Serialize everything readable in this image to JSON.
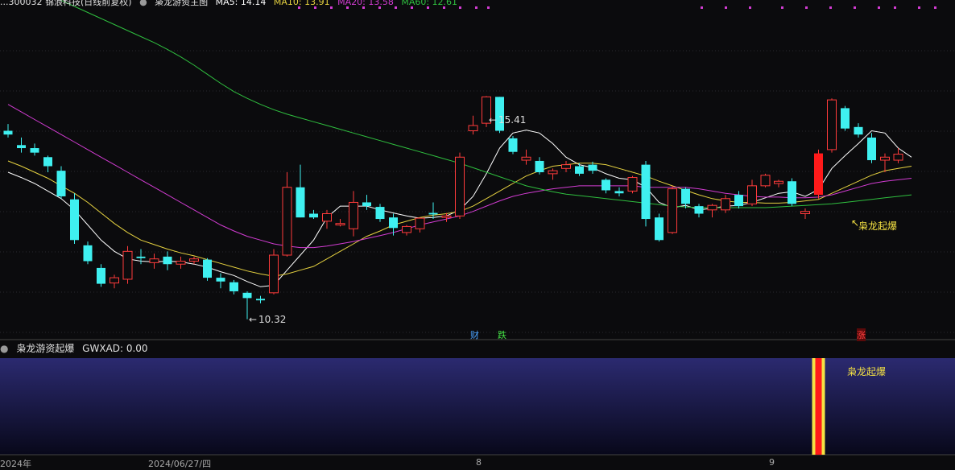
{
  "top_legend": {
    "stock": "...300032 锦浪科技(日线前复权)",
    "indicator_name": "枭龙游资主图",
    "ma5": "MA5: 14.14",
    "ma10": "MA10: 13.91",
    "ma20": "MA20: 13.58",
    "ma60": "MA60: 12.61"
  },
  "colors": {
    "up": "#ff3b3b",
    "down": "#3ff0f0",
    "ma5": "#ffffff",
    "ma10": "#e6d240",
    "ma20": "#d23cd2",
    "ma60": "#2fbf3f",
    "panel_top": "#2a2a6e",
    "panel_bottom": "#0a0a18"
  },
  "annotations": {
    "high": "15.41",
    "low": "10.32",
    "signal": "枭龙起爆",
    "badge_cai": "财",
    "badge_die": "跌",
    "badge_zhang": "涨"
  },
  "indicator": {
    "title": "枭龙游资起爆",
    "value_label": "GWXAD: 0.00",
    "bar_label": "枭龙起爆"
  },
  "x_axis": {
    "label_year": "2024年",
    "label_date": "2024/06/27/四",
    "label_month8": "8",
    "label_month9": "9"
  },
  "chart_data": {
    "type": "candlestick",
    "series": [
      {
        "name": "K",
        "ohlc": [
          [
            14.95,
            15.04,
            14.86,
            14.9
          ],
          [
            14.76,
            14.86,
            14.66,
            14.72
          ],
          [
            14.72,
            14.78,
            14.62,
            14.66
          ],
          [
            14.6,
            14.62,
            14.4,
            14.48
          ],
          [
            14.42,
            14.48,
            14.05,
            14.08
          ],
          [
            14.04,
            14.12,
            13.45,
            13.5
          ],
          [
            13.43,
            13.48,
            13.18,
            13.22
          ],
          [
            13.13,
            13.18,
            12.88,
            12.92
          ],
          [
            12.93,
            13.04,
            12.86,
            13.0
          ],
          [
            12.98,
            13.42,
            12.92,
            13.35
          ],
          [
            13.28,
            13.38,
            13.18,
            13.26
          ],
          [
            13.2,
            13.32,
            13.12,
            13.25
          ],
          [
            13.28,
            13.35,
            13.1,
            13.18
          ],
          [
            13.18,
            13.28,
            13.12,
            13.22
          ],
          [
            13.22,
            13.28,
            13.18,
            13.25
          ],
          [
            13.24,
            13.26,
            12.96,
            13.0
          ],
          [
            13.0,
            13.06,
            12.86,
            12.95
          ],
          [
            12.94,
            12.97,
            12.78,
            12.82
          ],
          [
            12.8,
            12.82,
            12.45,
            12.73
          ],
          [
            12.72,
            12.76,
            12.66,
            12.7
          ],
          [
            12.8,
            13.38,
            12.78,
            13.3
          ],
          [
            13.3,
            14.4,
            13.28,
            14.2
          ],
          [
            14.2,
            14.5,
            13.8,
            13.8
          ],
          [
            13.85,
            13.9,
            13.78,
            13.8
          ],
          [
            13.75,
            13.9,
            13.65,
            13.85
          ],
          [
            13.7,
            13.78,
            13.68,
            13.72
          ],
          [
            13.65,
            14.15,
            13.55,
            14.0
          ],
          [
            14.0,
            14.1,
            13.9,
            13.95
          ],
          [
            13.94,
            13.98,
            13.74,
            13.78
          ],
          [
            13.8,
            13.85,
            13.56,
            13.66
          ],
          [
            13.6,
            13.7,
            13.56,
            13.68
          ],
          [
            13.65,
            13.8,
            13.6,
            13.79
          ],
          [
            13.86,
            14.0,
            13.78,
            13.84
          ],
          [
            13.8,
            13.86,
            13.74,
            13.82
          ],
          [
            13.82,
            14.66,
            13.78,
            14.6
          ],
          [
            14.95,
            15.15,
            14.9,
            15.02
          ],
          [
            15.05,
            15.41,
            15.0,
            15.4
          ],
          [
            15.4,
            15.4,
            14.92,
            14.95
          ],
          [
            14.85,
            14.88,
            14.64,
            14.67
          ],
          [
            14.56,
            14.7,
            14.5,
            14.6
          ],
          [
            14.55,
            14.6,
            14.37,
            14.4
          ],
          [
            14.38,
            14.45,
            14.3,
            14.42
          ],
          [
            14.45,
            14.55,
            14.4,
            14.5
          ],
          [
            14.48,
            14.52,
            14.35,
            14.38
          ],
          [
            14.5,
            14.54,
            14.38,
            14.42
          ],
          [
            14.3,
            14.32,
            14.12,
            14.16
          ],
          [
            14.15,
            14.2,
            14.08,
            14.12
          ],
          [
            14.15,
            14.35,
            14.12,
            14.33
          ],
          [
            14.5,
            14.55,
            13.68,
            13.78
          ],
          [
            13.8,
            13.85,
            13.48,
            13.5
          ],
          [
            13.6,
            14.22,
            13.58,
            14.18
          ],
          [
            14.18,
            14.2,
            13.92,
            13.98
          ],
          [
            13.95,
            13.98,
            13.8,
            13.85
          ],
          [
            13.9,
            13.98,
            13.8,
            13.96
          ],
          [
            13.9,
            14.1,
            13.86,
            14.05
          ],
          [
            14.1,
            14.15,
            13.92,
            13.95
          ],
          [
            13.98,
            14.3,
            13.95,
            14.22
          ],
          [
            14.22,
            14.38,
            14.2,
            14.36
          ],
          [
            14.25,
            14.3,
            14.2,
            14.28
          ],
          [
            14.28,
            14.32,
            13.95,
            13.98
          ],
          [
            13.85,
            13.92,
            13.78,
            13.88
          ],
          [
            14.1,
            14.7,
            14.05,
            14.65
          ],
          [
            14.7,
            15.38,
            14.66,
            15.36
          ],
          [
            15.25,
            15.28,
            14.95,
            14.98
          ],
          [
            15.0,
            15.05,
            14.86,
            14.9
          ],
          [
            14.86,
            14.92,
            14.52,
            14.56
          ],
          [
            14.56,
            14.65,
            14.4,
            14.6
          ],
          [
            14.56,
            14.72,
            14.52,
            14.64
          ]
        ]
      },
      {
        "name": "MA5",
        "values": [
          14.4,
          14.33,
          14.25,
          14.15,
          14.05,
          13.9,
          13.7,
          13.5,
          13.35,
          13.25,
          13.22,
          13.21,
          13.22,
          13.21,
          13.18,
          13.14,
          13.08,
          13.03,
          12.95,
          12.88,
          12.9,
          13.1,
          13.3,
          13.5,
          13.8,
          13.95,
          13.95,
          13.95,
          13.9,
          13.86,
          13.82,
          13.79,
          13.8,
          13.82,
          13.9,
          14.08,
          14.38,
          14.72,
          14.92,
          14.96,
          14.92,
          14.78,
          14.6,
          14.5,
          14.46,
          14.38,
          14.32,
          14.3,
          14.2,
          14.0,
          13.93,
          13.96,
          13.9,
          13.92,
          13.95,
          13.96,
          14.0,
          14.06,
          14.12,
          14.14,
          14.08,
          14.17,
          14.45,
          14.62,
          14.78,
          14.95,
          14.92,
          14.72,
          14.6
        ]
      },
      {
        "name": "MA10",
        "values": [
          14.55,
          14.48,
          14.4,
          14.32,
          14.22,
          14.12,
          14.0,
          13.86,
          13.72,
          13.6,
          13.5,
          13.44,
          13.38,
          13.33,
          13.29,
          13.24,
          13.19,
          13.14,
          13.09,
          13.05,
          13.02,
          13.05,
          13.1,
          13.15,
          13.25,
          13.35,
          13.45,
          13.55,
          13.62,
          13.7,
          13.75,
          13.8,
          13.83,
          13.85,
          13.88,
          13.95,
          14.05,
          14.15,
          14.25,
          14.35,
          14.42,
          14.48,
          14.5,
          14.52,
          14.52,
          14.5,
          14.45,
          14.4,
          14.35,
          14.28,
          14.22,
          14.16,
          14.1,
          14.05,
          14.02,
          14.0,
          14.0,
          13.99,
          13.99,
          14.0,
          14.02,
          14.04,
          14.12,
          14.2,
          14.28,
          14.36,
          14.42,
          14.45,
          14.48
        ]
      },
      {
        "name": "MA20",
        "values": [
          15.3,
          15.2,
          15.1,
          15.0,
          14.9,
          14.8,
          14.7,
          14.6,
          14.5,
          14.4,
          14.3,
          14.2,
          14.1,
          14.0,
          13.9,
          13.8,
          13.7,
          13.62,
          13.55,
          13.5,
          13.45,
          13.42,
          13.4,
          13.4,
          13.42,
          13.45,
          13.48,
          13.52,
          13.56,
          13.6,
          13.65,
          13.7,
          13.74,
          13.78,
          13.82,
          13.88,
          13.95,
          14.02,
          14.08,
          14.12,
          14.15,
          14.18,
          14.2,
          14.22,
          14.22,
          14.22,
          14.22,
          14.22,
          14.2,
          14.2,
          14.2,
          14.2,
          14.18,
          14.15,
          14.12,
          14.1,
          14.08,
          14.07,
          14.07,
          14.06,
          14.06,
          14.07,
          14.1,
          14.15,
          14.2,
          14.25,
          14.28,
          14.3,
          14.32
        ]
      },
      {
        "name": "MA60",
        "values": [
          17.0,
          16.92,
          16.84,
          16.76,
          16.68,
          16.6,
          16.52,
          16.44,
          16.36,
          16.28,
          16.2,
          16.12,
          16.03,
          15.93,
          15.82,
          15.7,
          15.58,
          15.47,
          15.38,
          15.3,
          15.23,
          15.17,
          15.12,
          15.07,
          15.02,
          14.97,
          14.92,
          14.87,
          14.82,
          14.77,
          14.72,
          14.67,
          14.62,
          14.57,
          14.52,
          14.46,
          14.4,
          14.34,
          14.28,
          14.22,
          14.18,
          14.14,
          14.11,
          14.09,
          14.07,
          14.05,
          14.03,
          14.01,
          13.99,
          13.97,
          13.95,
          13.94,
          13.93,
          13.93,
          13.93,
          13.93,
          13.93,
          13.93,
          13.94,
          13.95,
          13.96,
          13.97,
          13.98,
          14.0,
          14.02,
          14.04,
          14.06,
          14.08,
          14.1
        ]
      }
    ],
    "signals": [
      61
    ],
    "ylim": [
      12.2,
      16.6
    ],
    "high_index": 36,
    "low_index": 19
  }
}
